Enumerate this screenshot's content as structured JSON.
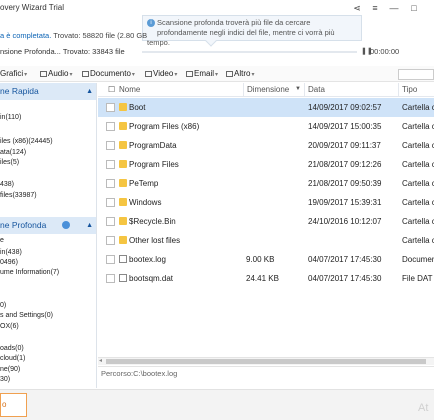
{
  "app": {
    "title": "overy Wizard Trial"
  },
  "window_controls": {
    "share": "⋖",
    "menu": "≡",
    "minimize": "—",
    "maximize": "□"
  },
  "status": {
    "line1_prefix": "a è completata.",
    "line1_found": "Trovato: 58820 file (2.80 GB",
    "line2": "nsione Profonda...  Trovato: 33843 file",
    "pause": "❚❚",
    "time": "00:00:00",
    "progress": 0.0
  },
  "tooltip": {
    "line1": "Scansione profonda troverà più file da cercare",
    "line2": "profondamente negli indici del file, mentre ci vorrà più tempo."
  },
  "filters": [
    {
      "label": "Grafici"
    },
    {
      "label": "Audio"
    },
    {
      "label": "Documento"
    },
    {
      "label": "Video"
    },
    {
      "label": "Email"
    },
    {
      "label": "Altro"
    }
  ],
  "left_panel": {
    "quick_header": "ne Rapida",
    "quick_items": [
      "in(110)",
      "iles (x86)(24445)",
      "ata(124)",
      "iles(5)",
      "438)",
      "files(33987)"
    ],
    "deep_header": "ne Profonda",
    "deep_items": [
      "e",
      "in(438)",
      "0496)",
      "ume Information(7)",
      "0)",
      "s and Settings(0)",
      "OX(6)",
      "oads(0)",
      "cloud(1)",
      "ne(90)",
      "30)"
    ]
  },
  "columns": {
    "name": "Nome",
    "size": "Dimensione",
    "date": "Data",
    "type": "Tipo"
  },
  "rows": [
    {
      "name": "Boot",
      "size": "",
      "date": "14/09/2017 09:02:57",
      "type": "Cartella c",
      "icon": "folder",
      "selected": true
    },
    {
      "name": "Program Files (x86)",
      "size": "",
      "date": "14/09/2017 15:00:35",
      "type": "Cartella c",
      "icon": "folder"
    },
    {
      "name": "ProgramData",
      "size": "",
      "date": "20/09/2017 09:11:37",
      "type": "Cartella c",
      "icon": "folder"
    },
    {
      "name": "Program Files",
      "size": "",
      "date": "21/08/2017 09:12:26",
      "type": "Cartella c",
      "icon": "folder"
    },
    {
      "name": "PeTemp",
      "size": "",
      "date": "21/08/2017 09:50:39",
      "type": "Cartella c",
      "icon": "folder"
    },
    {
      "name": "Windows",
      "size": "",
      "date": "19/09/2017 15:39:31",
      "type": "Cartella c",
      "icon": "folder"
    },
    {
      "name": "$Recycle.Bin",
      "size": "",
      "date": "24/10/2016 10:12:07",
      "type": "Cartella c",
      "icon": "folder"
    },
    {
      "name": "Other lost files",
      "size": "",
      "date": "",
      "type": "Cartella c",
      "icon": "folder"
    },
    {
      "name": "bootex.log",
      "size": "9.00 KB",
      "date": "04/07/2017 17:45:30",
      "type": "Documen",
      "icon": "file"
    },
    {
      "name": "bootsqm.dat",
      "size": "24.41 KB",
      "date": "04/07/2017 17:45:30",
      "type": "File DAT",
      "icon": "file"
    }
  ],
  "path": "Percorso:C:\\bootex.log",
  "bottom": {
    "button": "o",
    "watermark": "At"
  }
}
